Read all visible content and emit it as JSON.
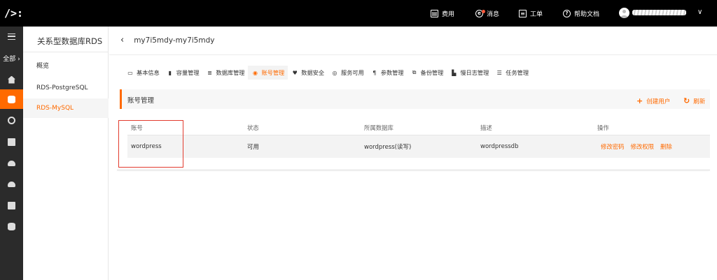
{
  "topbar": {
    "logo": "/>:",
    "items": [
      {
        "label": "费用",
        "icon": "billing-icon"
      },
      {
        "label": "消息",
        "icon": "message-icon"
      },
      {
        "label": "工单",
        "icon": "ticket-icon"
      },
      {
        "label": "帮助文档",
        "icon": "help-icon"
      }
    ],
    "user_menu_chevron": "∨"
  },
  "rail": {
    "all_label": "全部 ›",
    "icons": [
      "menu-icon",
      "home-icon",
      "database-icon",
      "globe-icon",
      "storage-icon",
      "cloud-upload-icon",
      "cloud-icon",
      "close-box-icon",
      "stack-icon"
    ]
  },
  "sidemenu": {
    "title": "关系型数据库RDS",
    "items": [
      "概览",
      "RDS-PostgreSQL",
      "RDS-MySQL"
    ],
    "active_index": 2
  },
  "content": {
    "breadcrumb": "my7i5mdy-my7i5mdy",
    "tabs": [
      "基本信息",
      "容量管理",
      "数据库管理",
      "账号管理",
      "数据安全",
      "服务可用",
      "参数管理",
      "备份管理",
      "慢日志管理",
      "任务管理"
    ],
    "active_tab_index": 3,
    "section_title": "账号管理",
    "actions": {
      "create_user": "创建用户",
      "refresh": "刷新"
    },
    "table": {
      "columns": [
        "账号",
        "状态",
        "所属数据库",
        "描述",
        "操作"
      ],
      "rows": [
        {
          "account": "wordpress",
          "status": "可用",
          "database": "wordpress(读写)",
          "description": "wordpressdb",
          "operations": [
            "修改密码",
            "修改权限",
            "删除"
          ]
        }
      ]
    }
  },
  "colors": {
    "accent": "#ff6a00",
    "topbar_bg": "#000000",
    "rail_bg": "#2b2b2b",
    "highlight_box": "#e23b2e"
  }
}
